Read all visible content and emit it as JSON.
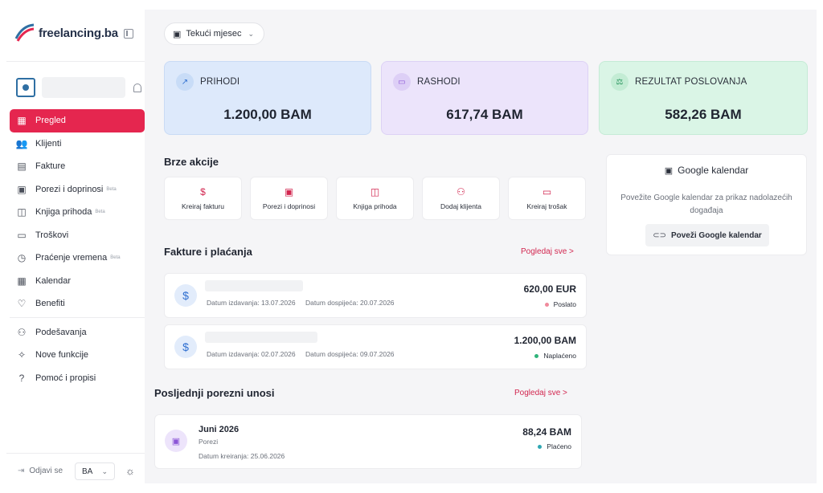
{
  "brand": {
    "name": "freelancing.ba"
  },
  "sidebar": {
    "items": [
      {
        "label": "Pregled",
        "icon": "dashboard-icon",
        "active": true
      },
      {
        "label": "Klijenti",
        "icon": "users-icon"
      },
      {
        "label": "Fakture",
        "icon": "document-icon"
      },
      {
        "label": "Porezi i doprinosi",
        "icon": "tax-icon",
        "badge": "Beta"
      },
      {
        "label": "Knjiga prihoda",
        "icon": "book-icon",
        "badge": "Beta"
      },
      {
        "label": "Troškovi",
        "icon": "wallet-icon"
      },
      {
        "label": "Praćenje vremena",
        "icon": "clock-icon",
        "badge": "Beta"
      },
      {
        "label": "Kalendar",
        "icon": "calendar-icon"
      },
      {
        "label": "Benefiti",
        "icon": "heart-icon"
      }
    ],
    "secondary": [
      {
        "label": "Podešavanja",
        "icon": "user-settings-icon"
      },
      {
        "label": "Nove funkcije",
        "icon": "sparkle-icon"
      },
      {
        "label": "Pomoć i propisi",
        "icon": "help-icon"
      }
    ],
    "logout": "Odjavi se",
    "language": "BA"
  },
  "header": {
    "period": "Tekući mjesec"
  },
  "stats": {
    "income": {
      "label": "PRIHODI",
      "value": "1.200,00 BAM",
      "color": "#dde9fb"
    },
    "expenses": {
      "label": "RASHODI",
      "value": "617,74 BAM",
      "color": "#ece4fb"
    },
    "result": {
      "label": "REZULTAT POSLOVANJA",
      "value": "582,26 BAM",
      "color": "#daf5e6"
    }
  },
  "quick_actions": {
    "title": "Brze akcije",
    "items": [
      {
        "label": "Kreiraj fakturu",
        "icon": "dollar-icon"
      },
      {
        "label": "Porezi i doprinosi",
        "icon": "tax-doc-icon"
      },
      {
        "label": "Knjiga prihoda",
        "icon": "book-icon"
      },
      {
        "label": "Dodaj klijenta",
        "icon": "users-icon"
      },
      {
        "label": "Kreiraj trošak",
        "icon": "wallet-icon"
      }
    ]
  },
  "google_calendar": {
    "title": "Google kalendar",
    "description": "Povežite Google kalendar za prikaz nadolazećih događaja",
    "button": "Poveži Google kalendar"
  },
  "invoices": {
    "title": "Fakture i plaćanja",
    "see_all": "Pogledaj sve >",
    "items": [
      {
        "issued": "Datum izdavanja: 13.07.2026",
        "due": "Datum dospijeća: 20.07.2026",
        "amount": "620,00 EUR",
        "status": "Poslato",
        "status_color": "#f08a9c"
      },
      {
        "issued": "Datum izdavanja: 02.07.2026",
        "due": "Datum dospijeća: 09.07.2026",
        "amount": "1.200,00 BAM",
        "status": "Naplaćeno",
        "status_color": "#2fb37a"
      }
    ]
  },
  "tax_entries": {
    "title": "Posljednji porezni unosi",
    "see_all": "Pogledaj sve >",
    "items": [
      {
        "title": "Juni 2026",
        "subtitle": "Porezi",
        "date": "Datum kreiranja: 25.06.2026",
        "amount": "88,24 BAM",
        "status": "Plaćeno",
        "status_color": "#2fa7b3"
      }
    ]
  },
  "colors": {
    "accent": "#e5264f",
    "link": "#d2264f"
  }
}
